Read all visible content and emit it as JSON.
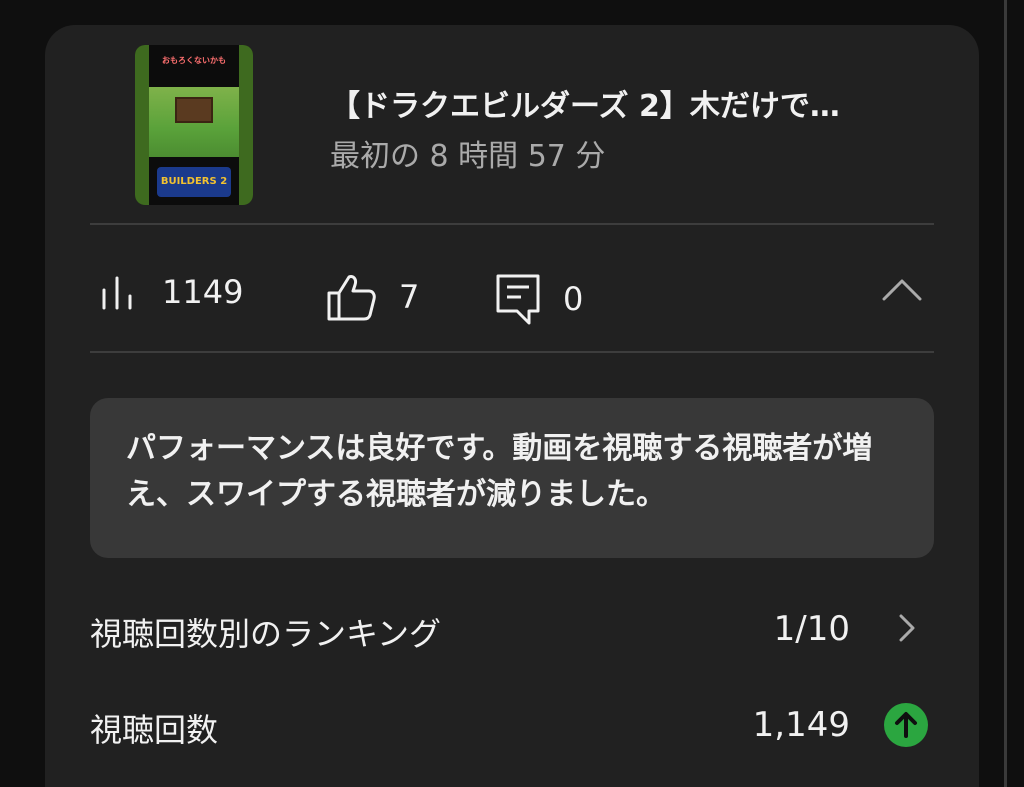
{
  "video": {
    "title": "【ドラクエビルダーズ 2】木だけで…",
    "subtitle": "最初の 8 時間 57 分",
    "thumbnail_caption": "おもろくないかも",
    "thumbnail_logo": "BUILDERS 2"
  },
  "stats": {
    "views": "1149",
    "likes": "7",
    "comments": "0"
  },
  "message": "パフォーマンスは良好です。動画を視聴する視聴者が増え、スワイプする視聴者が減りました。",
  "rows": [
    {
      "label": "視聴回数別のランキング",
      "value": "1/10"
    },
    {
      "label": "視聴回数",
      "value": "1,149"
    }
  ],
  "colors": {
    "card_bg": "#212121",
    "message_bg": "#383838",
    "up_badge": "#2ba640"
  }
}
